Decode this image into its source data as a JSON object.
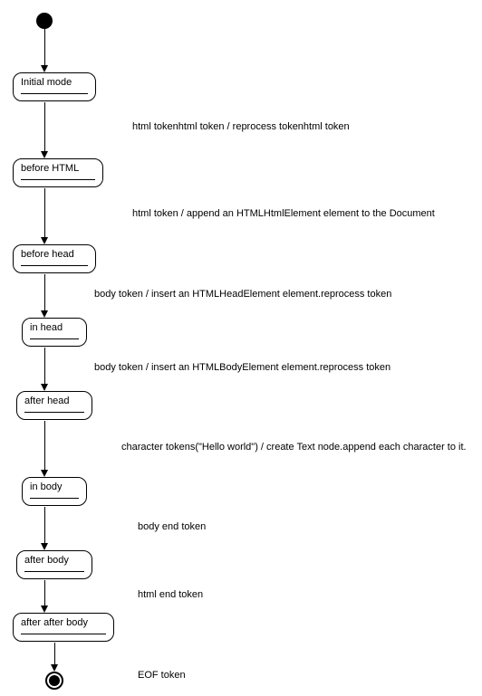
{
  "states": {
    "initial": "Initial mode",
    "beforeHtml": "before HTML",
    "beforeHead": "before head",
    "inHead": "in head",
    "afterHead": "after head",
    "inBody": "in body",
    "afterBody": "after body",
    "afterAfterBody": "after after body"
  },
  "transitions": {
    "t1": "html tokenhtml token / reprocess tokenhtml token",
    "t2": "html token / append an HTMLHtmlElement element to the Document",
    "t3": "body token / insert an HTMLHeadElement element.reprocess token",
    "t4": "body token / insert an HTMLBodyElement element.reprocess token",
    "t5": "character tokens(\"Hello world\") / create Text node.append each character to it.",
    "t6": "body end token",
    "t7": "html end token",
    "t8": "EOF token"
  },
  "chart_data": {
    "type": "state-diagram",
    "title": "",
    "initial": "start",
    "final": "end",
    "nodes": [
      {
        "id": "start",
        "kind": "initial"
      },
      {
        "id": "initial_mode",
        "label": "Initial mode"
      },
      {
        "id": "before_html",
        "label": "before HTML"
      },
      {
        "id": "before_head",
        "label": "before head"
      },
      {
        "id": "in_head",
        "label": "in head"
      },
      {
        "id": "after_head",
        "label": "after head"
      },
      {
        "id": "in_body",
        "label": "in body"
      },
      {
        "id": "after_body",
        "label": "after body"
      },
      {
        "id": "after_after_body",
        "label": "after after body"
      },
      {
        "id": "end",
        "kind": "final"
      }
    ],
    "edges": [
      {
        "from": "start",
        "to": "initial_mode",
        "label": ""
      },
      {
        "from": "initial_mode",
        "to": "before_html",
        "label": "html tokenhtml token / reprocess tokenhtml token"
      },
      {
        "from": "before_html",
        "to": "before_head",
        "label": "html token / append an HTMLHtmlElement element to the Document"
      },
      {
        "from": "before_head",
        "to": "in_head",
        "label": "body token / insert an HTMLHeadElement element.reprocess token"
      },
      {
        "from": "in_head",
        "to": "after_head",
        "label": "body token / insert an HTMLBodyElement element.reprocess token"
      },
      {
        "from": "after_head",
        "to": "in_body",
        "label": "character tokens(\"Hello world\") / create Text node.append each character to it."
      },
      {
        "from": "in_body",
        "to": "after_body",
        "label": "body end token"
      },
      {
        "from": "after_body",
        "to": "after_after_body",
        "label": "html end token"
      },
      {
        "from": "after_after_body",
        "to": "end",
        "label": "EOF token"
      }
    ]
  }
}
